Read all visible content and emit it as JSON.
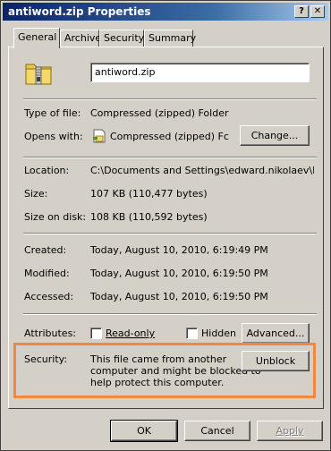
{
  "window": {
    "title": "antiword.zip Properties",
    "help_button": "?",
    "close_button": "✕"
  },
  "tabs": [
    {
      "label": "General",
      "active": true
    },
    {
      "label": "Archive",
      "active": false
    },
    {
      "label": "Security",
      "active": false
    },
    {
      "label": "Summary",
      "active": false
    }
  ],
  "general": {
    "file_name": "antiword.zip",
    "type_label": "Type of file:",
    "type_value": "Compressed (zipped) Folder",
    "opens_label": "Opens with:",
    "opens_value": "Compressed (zipped) Fc",
    "change_button": "Change...",
    "location_label": "Location:",
    "location_value": "C:\\Documents and Settings\\edward.nikolaev\\My Dc",
    "size_label": "Size:",
    "size_value": "107 KB (110,477 bytes)",
    "size_on_disk_label": "Size on disk:",
    "size_on_disk_value": "108 KB (110,592 bytes)",
    "created_label": "Created:",
    "created_value": "Today, August 10, 2010, 6:19:49 PM",
    "modified_label": "Modified:",
    "modified_value": "Today, August 10, 2010, 6:19:50 PM",
    "accessed_label": "Accessed:",
    "accessed_value": "Today, August 10, 2010, 6:19:50 PM",
    "attributes_label": "Attributes:",
    "readonly_label": "Read-only",
    "readonly_checked": false,
    "hidden_label": "Hidden",
    "hidden_checked": false,
    "advanced_button": "Advanced...",
    "security_label": "Security:",
    "security_message_lines": [
      "This file came from another",
      "computer and might be blocked to",
      "help protect this computer."
    ],
    "unblock_button": "Unblock"
  },
  "footer": {
    "ok_button": "OK",
    "cancel_button": "Cancel",
    "apply_button": "Apply",
    "apply_enabled": false
  },
  "colors": {
    "title_gradient_start": "#0a246a",
    "dialog_face": "#d4d0c8",
    "highlight_frame": "#f0883e"
  },
  "icons": {
    "folder": "zip-folder-icon",
    "opens_with": "compressed-folder-app-icon"
  }
}
